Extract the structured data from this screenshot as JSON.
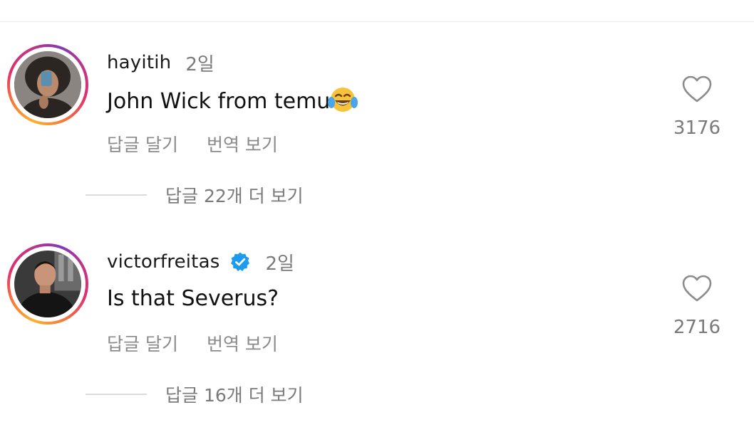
{
  "comments": [
    {
      "username": "hayitih",
      "time": "2일",
      "verified": false,
      "text": "John Wick from temu",
      "emoji": "face-with-tears-of-joy",
      "reply_label": "답글 달기",
      "translate_label": "번역 보기",
      "like_count": "3176",
      "view_replies": "답글 22개 더 보기"
    },
    {
      "username": "victorfreitas",
      "time": "2일",
      "verified": true,
      "text": "Is that Severus?",
      "reply_label": "답글 달기",
      "translate_label": "번역 보기",
      "like_count": "2716",
      "view_replies": "답글 16개 더 보기"
    }
  ],
  "colors": {
    "verified_badge": "#1d9bf0",
    "secondary_text": "#7a7a7a",
    "primary_text": "#111111",
    "story_ring": [
      "#f9b233",
      "#f77737",
      "#e1306c",
      "#c13584",
      "#833ab4"
    ]
  },
  "icons": {
    "like": "heart-outline-icon",
    "verified": "verified-badge-icon"
  }
}
